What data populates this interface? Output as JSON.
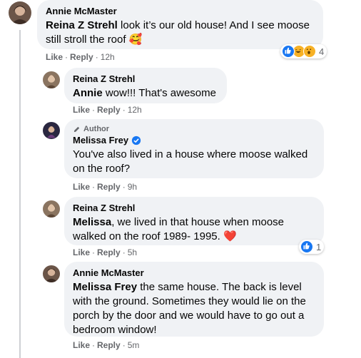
{
  "comments": [
    {
      "author": "Annie McMaster",
      "mention": "Reina Z Strehl",
      "text_line1": " look it’s our old house! And I see moose",
      "text_line2": "still stroll the roof ",
      "emoji": "🥰",
      "like": "Like",
      "reply": "Reply",
      "time": "12h",
      "reaction_count": "4"
    },
    {
      "author": "Reina Z Strehl",
      "mention": "Annie",
      "text": " wow!!! That's awesome",
      "like": "Like",
      "reply": "Reply",
      "time": "12h"
    },
    {
      "badge": "Author",
      "author": "Melissa Frey",
      "text_line1": "You've also lived in a house where moose walked",
      "text_line2": "on the roof?",
      "like": "Like",
      "reply": "Reply",
      "time": "9h"
    },
    {
      "author": "Reina Z Strehl",
      "mention": "Melissa",
      "text_line1": ", we lived in that house when moose",
      "text_line2": "walked on the roof 1989- 1995. ",
      "emoji": "❤️",
      "like": "Like",
      "reply": "Reply",
      "time": "5h",
      "reaction_count": "1"
    },
    {
      "author": "Annie McMaster",
      "mention": "Melissa Frey",
      "text_line1": " the same house. The back is level",
      "text_line2": "with the ground. Sometimes they would lie on the",
      "text_line3": "porch by the door and we would have to go out a",
      "text_line4": "bedroom window!",
      "like": "Like",
      "reply": "Reply",
      "time": "5m"
    }
  ],
  "colors": {
    "bubble": "#f0f2f5",
    "meta": "#65676b",
    "like_blue": "#1877f2",
    "heart_red": "#f33e58",
    "haha_yellow": "#f7b125"
  }
}
